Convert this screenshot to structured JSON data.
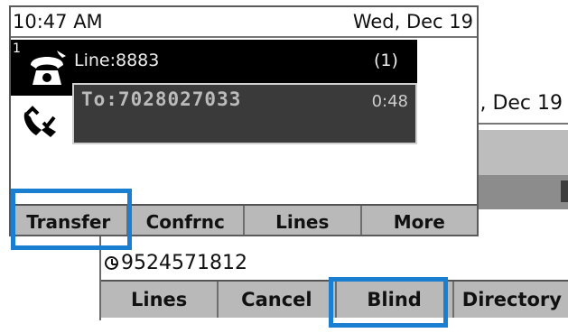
{
  "status_bar": {
    "time": "10:47 AM",
    "date": "Wed, Dec 19"
  },
  "back_screen": {
    "date_partial": ", Dec 19",
    "caller_number": "9524571812",
    "softkeys": [
      "Lines",
      "Cancel",
      "Blind",
      "Directory"
    ]
  },
  "line": {
    "index": "1",
    "label": "Line:8883",
    "count": "(1)"
  },
  "call": {
    "to": "To:7028027033",
    "timer": "0:48"
  },
  "front_softkeys": [
    "Transfer",
    "Confrnc",
    "Lines",
    "More"
  ],
  "icons": {
    "line": "phone-line-icon",
    "active_call": "active-call-icon",
    "recent_call": "clock-icon"
  },
  "colors": {
    "highlight": "#1b7fd1",
    "softkey_bar": "#b9b9b9",
    "line_panel": "#000000",
    "call_box": "#3a3a3a"
  }
}
